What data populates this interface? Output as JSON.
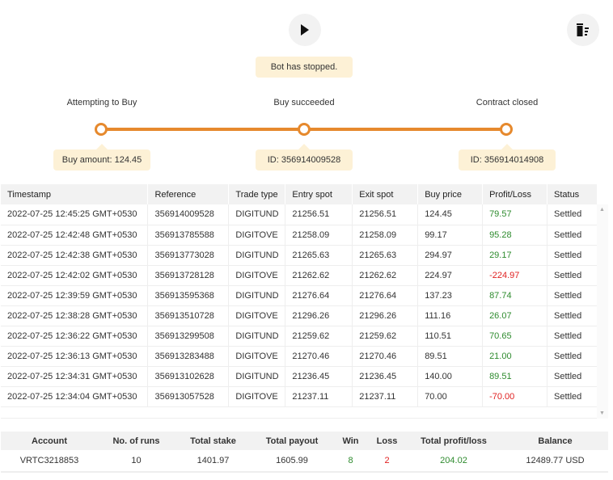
{
  "status_message": "Bot has stopped.",
  "steps": [
    {
      "label": "Attempting to Buy",
      "info": "Buy amount: 124.45"
    },
    {
      "label": "Buy succeeded",
      "info": "ID: 356914009528"
    },
    {
      "label": "Contract closed",
      "info": "ID: 356914014908"
    }
  ],
  "log": {
    "headers": [
      "Timestamp",
      "Reference",
      "Trade type",
      "Entry spot",
      "Exit spot",
      "Buy price",
      "Profit/Loss",
      "Status"
    ],
    "rows": [
      [
        "2022-07-25 12:45:25 GMT+0530",
        "356914009528",
        "DIGITUND",
        "21256.51",
        "21256.51",
        "124.45",
        "79.57",
        "Settled"
      ],
      [
        "2022-07-25 12:42:48 GMT+0530",
        "356913785588",
        "DIGITOVE",
        "21258.09",
        "21258.09",
        "99.17",
        "95.28",
        "Settled"
      ],
      [
        "2022-07-25 12:42:38 GMT+0530",
        "356913773028",
        "DIGITUND",
        "21265.63",
        "21265.63",
        "294.97",
        "29.17",
        "Settled"
      ],
      [
        "2022-07-25 12:42:02 GMT+0530",
        "356913728128",
        "DIGITOVE",
        "21262.62",
        "21262.62",
        "224.97",
        "-224.97",
        "Settled"
      ],
      [
        "2022-07-25 12:39:59 GMT+0530",
        "356913595368",
        "DIGITUND",
        "21276.64",
        "21276.64",
        "137.23",
        "87.74",
        "Settled"
      ],
      [
        "2022-07-25 12:38:28 GMT+0530",
        "356913510728",
        "DIGITOVE",
        "21296.26",
        "21296.26",
        "111.16",
        "26.07",
        "Settled"
      ],
      [
        "2022-07-25 12:36:22 GMT+0530",
        "356913299508",
        "DIGITUND",
        "21259.62",
        "21259.62",
        "110.51",
        "70.65",
        "Settled"
      ],
      [
        "2022-07-25 12:36:13 GMT+0530",
        "356913283488",
        "DIGITOVE",
        "21270.46",
        "21270.46",
        "89.51",
        "21.00",
        "Settled"
      ],
      [
        "2022-07-25 12:34:31 GMT+0530",
        "356913102628",
        "DIGITUND",
        "21236.45",
        "21236.45",
        "140.00",
        "89.51",
        "Settled"
      ],
      [
        "2022-07-25 12:34:04 GMT+0530",
        "356913057528",
        "DIGITOVE",
        "21237.11",
        "21237.11",
        "70.00",
        "-70.00",
        "Settled"
      ]
    ]
  },
  "summary": {
    "headers": [
      "Account",
      "No. of runs",
      "Total stake",
      "Total payout",
      "Win",
      "Loss",
      "Total profit/loss",
      "Balance"
    ],
    "values": [
      "VRTC3218853",
      "10",
      "1401.97",
      "1605.99",
      "8",
      "2",
      "204.02",
      "12489.77 USD"
    ]
  },
  "colors": {
    "accent": "#e6892d",
    "tooltip": "#fdf1d6",
    "profit": "#2e8b2e",
    "loss": "#e02020"
  }
}
